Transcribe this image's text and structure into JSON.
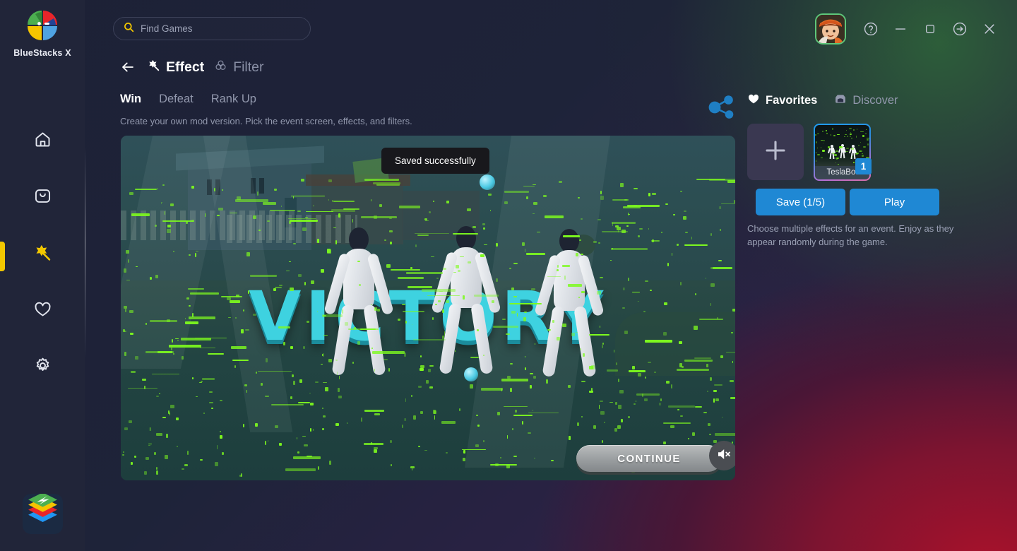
{
  "brand": {
    "name": "BlueStacks X",
    "logo_icon": "bluestacks-pinwheel-icon",
    "tray_icon": "bluestacks-stack-icon"
  },
  "search": {
    "placeholder": "Find Games",
    "icon": "search-icon"
  },
  "window_controls": {
    "avatar_icon": "user-avatar",
    "help_label": "?",
    "help_icon": "help-circle-icon",
    "minimize_icon": "minimize-icon",
    "maximize_icon": "maximize-icon",
    "exit_icon": "exit-arrow-icon",
    "close_icon": "close-icon"
  },
  "sidebar": {
    "items": [
      {
        "name": "home",
        "icon": "home-icon",
        "active": false
      },
      {
        "name": "my-games",
        "icon": "bag-icon",
        "active": false
      },
      {
        "name": "effects",
        "icon": "magic-wand-icon",
        "active": true
      },
      {
        "name": "favorites",
        "icon": "heart-icon",
        "active": false
      },
      {
        "name": "settings",
        "icon": "gear-icon",
        "active": false
      }
    ]
  },
  "header": {
    "back_icon": "back-arrow-icon",
    "tabs": [
      {
        "label": "Effect",
        "icon": "magic-wand-icon",
        "selected": true
      },
      {
        "label": "Filter",
        "icon": "filter-circles-icon",
        "selected": false
      }
    ]
  },
  "modes": [
    {
      "label": "Win",
      "selected": true
    },
    {
      "label": "Defeat",
      "selected": false
    },
    {
      "label": "Rank Up",
      "selected": false
    }
  ],
  "subtitle": "Create your own mod version. Pick the event screen, effects, and filters.",
  "preview": {
    "toast": "Saved successfully",
    "victory_text": "VICTORY",
    "continue_label": "CONTINUE",
    "mute_icon": "speaker-mute-icon"
  },
  "right_panel": {
    "share_icon": "share-icon",
    "tabs": [
      {
        "label": "Favorites",
        "icon": "heart-filled-icon",
        "selected": true
      },
      {
        "label": "Discover",
        "icon": "store-icon",
        "selected": false
      }
    ],
    "add_card": {
      "icon": "plus-icon"
    },
    "effect_cards": [
      {
        "name": "TeslaBot",
        "badge": "1"
      }
    ],
    "buttons": {
      "save_label": "Save (1/5)",
      "play_label": "Play"
    },
    "hint": "Choose multiple effects for an event. Enjoy as they appear randomly during the game."
  },
  "colors": {
    "accent_blue": "#1f88d4",
    "accent_yellow": "#f2c700",
    "victory_cyan": "#3ed2e0",
    "splatter_green": "#7dfa1e"
  }
}
